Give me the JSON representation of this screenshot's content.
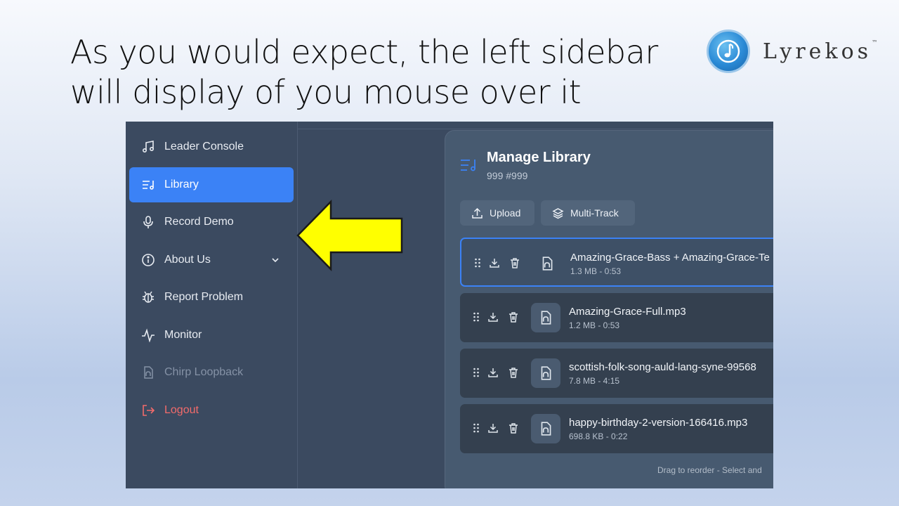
{
  "slide": {
    "title": "As you would expect, the left sidebar will display of you mouse over it",
    "brand_name": "Lyrekos",
    "brand_tm": "™"
  },
  "sidebar": {
    "items": [
      {
        "label": "Leader Console",
        "icon": "music-notes-icon",
        "state": "normal"
      },
      {
        "label": "Library",
        "icon": "library-list-icon",
        "state": "active"
      },
      {
        "label": "Record Demo",
        "icon": "microphone-icon",
        "state": "normal"
      },
      {
        "label": "About Us",
        "icon": "info-icon",
        "state": "normal",
        "expandable": true
      },
      {
        "label": "Report Problem",
        "icon": "bug-icon",
        "state": "normal"
      },
      {
        "label": "Monitor",
        "icon": "activity-icon",
        "state": "normal"
      },
      {
        "label": "Chirp Loopback",
        "icon": "audio-file-icon",
        "state": "disabled"
      },
      {
        "label": "Logout",
        "icon": "logout-icon",
        "state": "danger"
      }
    ]
  },
  "panel": {
    "title": "Manage Library",
    "subtitle": "999 #999",
    "buttons": {
      "upload": "Upload",
      "multitrack": "Multi-Track"
    },
    "tracks": [
      {
        "name": "Amazing-Grace-Bass + Amazing-Grace-Te",
        "meta": "1.3 MB - 0:53",
        "selected": true
      },
      {
        "name": "Amazing-Grace-Full.mp3",
        "meta": "1.2 MB - 0:53",
        "selected": false
      },
      {
        "name": "scottish-folk-song-auld-lang-syne-99568",
        "meta": "7.8 MB - 4:15",
        "selected": false
      },
      {
        "name": "happy-birthday-2-version-166416.mp3",
        "meta": "698.8 KB - 0:22",
        "selected": false
      }
    ],
    "footer_hint": "Drag to reorder - Select and"
  },
  "colors": {
    "accent": "#3b82f6",
    "sidebar_bg": "#3b4a60",
    "danger": "#f26b6b",
    "callout_arrow": "#ffff00"
  }
}
